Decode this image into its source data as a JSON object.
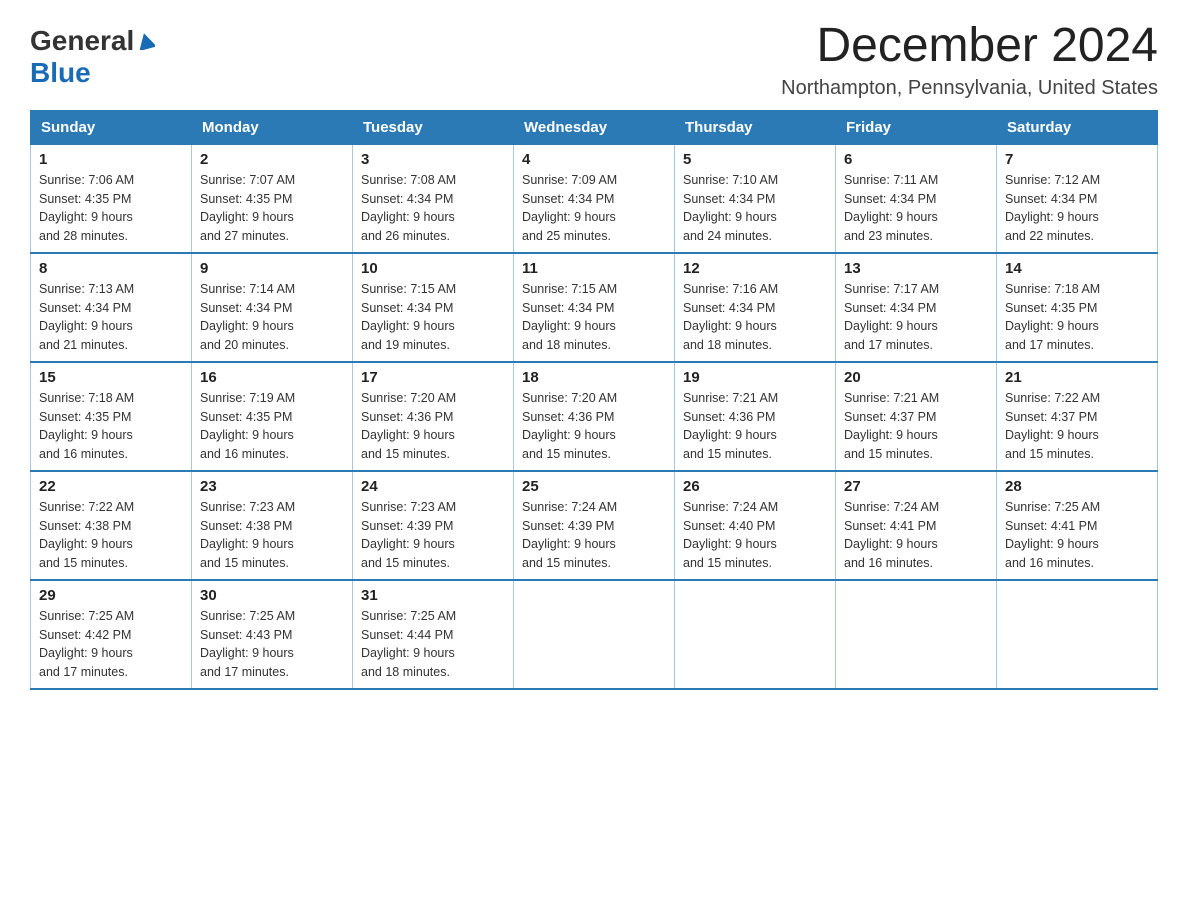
{
  "logo": {
    "general": "General",
    "blue": "Blue"
  },
  "title": "December 2024",
  "location": "Northampton, Pennsylvania, United States",
  "days_of_week": [
    "Sunday",
    "Monday",
    "Tuesday",
    "Wednesday",
    "Thursday",
    "Friday",
    "Saturday"
  ],
  "weeks": [
    [
      {
        "day": "1",
        "sunrise": "7:06 AM",
        "sunset": "4:35 PM",
        "daylight": "9 hours and 28 minutes."
      },
      {
        "day": "2",
        "sunrise": "7:07 AM",
        "sunset": "4:35 PM",
        "daylight": "9 hours and 27 minutes."
      },
      {
        "day": "3",
        "sunrise": "7:08 AM",
        "sunset": "4:34 PM",
        "daylight": "9 hours and 26 minutes."
      },
      {
        "day": "4",
        "sunrise": "7:09 AM",
        "sunset": "4:34 PM",
        "daylight": "9 hours and 25 minutes."
      },
      {
        "day": "5",
        "sunrise": "7:10 AM",
        "sunset": "4:34 PM",
        "daylight": "9 hours and 24 minutes."
      },
      {
        "day": "6",
        "sunrise": "7:11 AM",
        "sunset": "4:34 PM",
        "daylight": "9 hours and 23 minutes."
      },
      {
        "day": "7",
        "sunrise": "7:12 AM",
        "sunset": "4:34 PM",
        "daylight": "9 hours and 22 minutes."
      }
    ],
    [
      {
        "day": "8",
        "sunrise": "7:13 AM",
        "sunset": "4:34 PM",
        "daylight": "9 hours and 21 minutes."
      },
      {
        "day": "9",
        "sunrise": "7:14 AM",
        "sunset": "4:34 PM",
        "daylight": "9 hours and 20 minutes."
      },
      {
        "day": "10",
        "sunrise": "7:15 AM",
        "sunset": "4:34 PM",
        "daylight": "9 hours and 19 minutes."
      },
      {
        "day": "11",
        "sunrise": "7:15 AM",
        "sunset": "4:34 PM",
        "daylight": "9 hours and 18 minutes."
      },
      {
        "day": "12",
        "sunrise": "7:16 AM",
        "sunset": "4:34 PM",
        "daylight": "9 hours and 18 minutes."
      },
      {
        "day": "13",
        "sunrise": "7:17 AM",
        "sunset": "4:34 PM",
        "daylight": "9 hours and 17 minutes."
      },
      {
        "day": "14",
        "sunrise": "7:18 AM",
        "sunset": "4:35 PM",
        "daylight": "9 hours and 17 minutes."
      }
    ],
    [
      {
        "day": "15",
        "sunrise": "7:18 AM",
        "sunset": "4:35 PM",
        "daylight": "9 hours and 16 minutes."
      },
      {
        "day": "16",
        "sunrise": "7:19 AM",
        "sunset": "4:35 PM",
        "daylight": "9 hours and 16 minutes."
      },
      {
        "day": "17",
        "sunrise": "7:20 AM",
        "sunset": "4:36 PM",
        "daylight": "9 hours and 15 minutes."
      },
      {
        "day": "18",
        "sunrise": "7:20 AM",
        "sunset": "4:36 PM",
        "daylight": "9 hours and 15 minutes."
      },
      {
        "day": "19",
        "sunrise": "7:21 AM",
        "sunset": "4:36 PM",
        "daylight": "9 hours and 15 minutes."
      },
      {
        "day": "20",
        "sunrise": "7:21 AM",
        "sunset": "4:37 PM",
        "daylight": "9 hours and 15 minutes."
      },
      {
        "day": "21",
        "sunrise": "7:22 AM",
        "sunset": "4:37 PM",
        "daylight": "9 hours and 15 minutes."
      }
    ],
    [
      {
        "day": "22",
        "sunrise": "7:22 AM",
        "sunset": "4:38 PM",
        "daylight": "9 hours and 15 minutes."
      },
      {
        "day": "23",
        "sunrise": "7:23 AM",
        "sunset": "4:38 PM",
        "daylight": "9 hours and 15 minutes."
      },
      {
        "day": "24",
        "sunrise": "7:23 AM",
        "sunset": "4:39 PM",
        "daylight": "9 hours and 15 minutes."
      },
      {
        "day": "25",
        "sunrise": "7:24 AM",
        "sunset": "4:39 PM",
        "daylight": "9 hours and 15 minutes."
      },
      {
        "day": "26",
        "sunrise": "7:24 AM",
        "sunset": "4:40 PM",
        "daylight": "9 hours and 15 minutes."
      },
      {
        "day": "27",
        "sunrise": "7:24 AM",
        "sunset": "4:41 PM",
        "daylight": "9 hours and 16 minutes."
      },
      {
        "day": "28",
        "sunrise": "7:25 AM",
        "sunset": "4:41 PM",
        "daylight": "9 hours and 16 minutes."
      }
    ],
    [
      {
        "day": "29",
        "sunrise": "7:25 AM",
        "sunset": "4:42 PM",
        "daylight": "9 hours and 17 minutes."
      },
      {
        "day": "30",
        "sunrise": "7:25 AM",
        "sunset": "4:43 PM",
        "daylight": "9 hours and 17 minutes."
      },
      {
        "day": "31",
        "sunrise": "7:25 AM",
        "sunset": "4:44 PM",
        "daylight": "9 hours and 18 minutes."
      },
      null,
      null,
      null,
      null
    ]
  ],
  "labels": {
    "sunrise": "Sunrise:",
    "sunset": "Sunset:",
    "daylight": "Daylight:"
  }
}
